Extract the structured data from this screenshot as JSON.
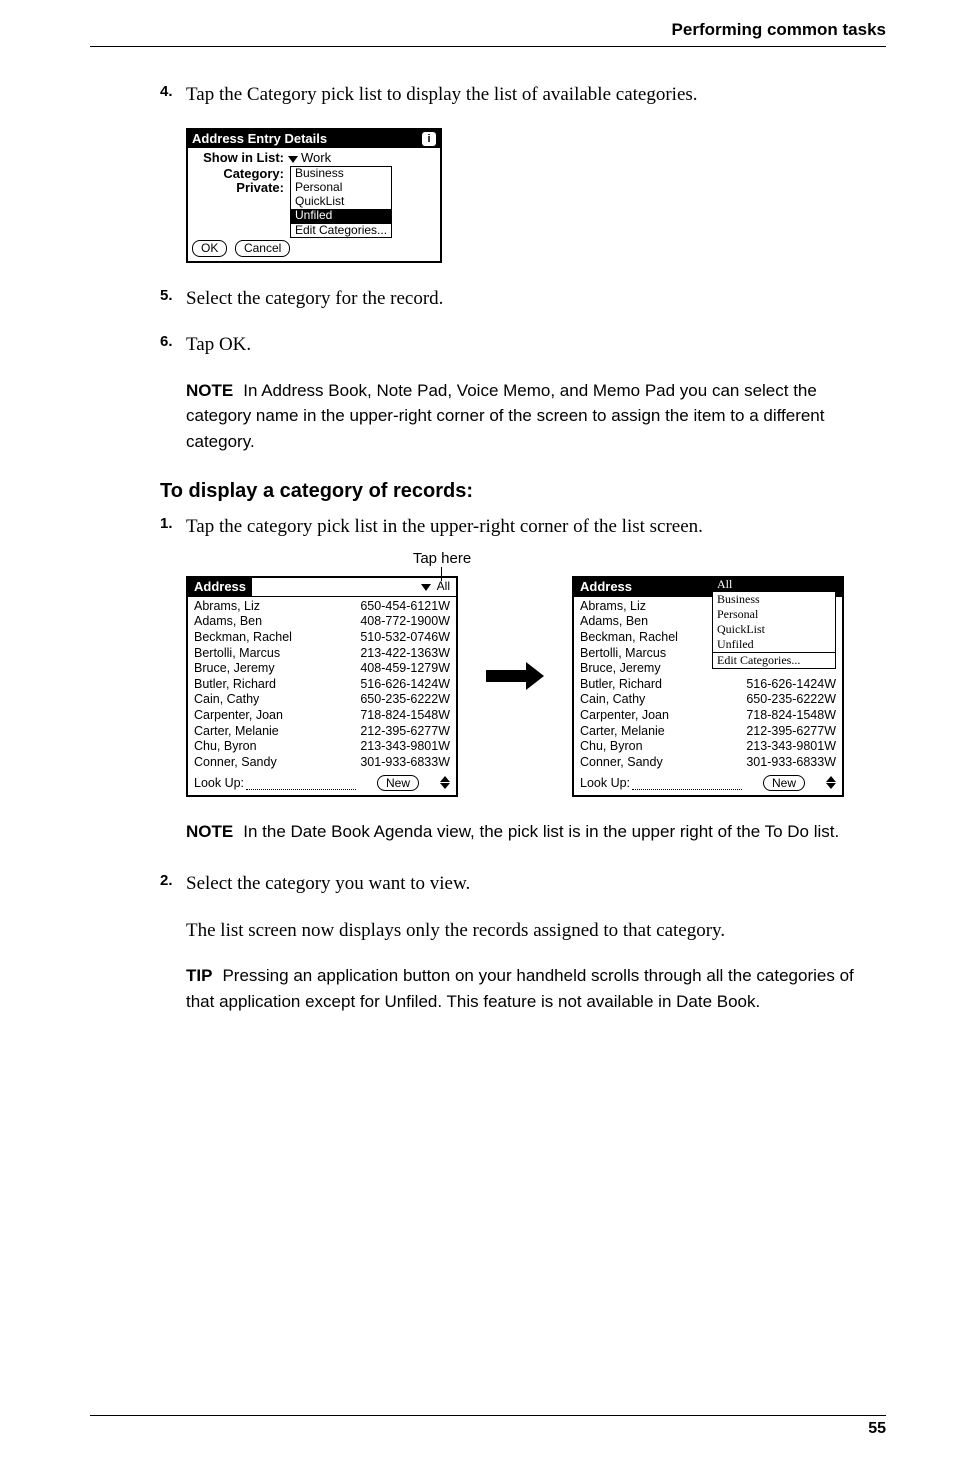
{
  "header": {
    "title": "Performing common tasks"
  },
  "steps_a": [
    {
      "num": "4.",
      "text": "Tap the Category pick list to display the list of available categories."
    },
    {
      "num": "5.",
      "text": "Select the category for the record."
    },
    {
      "num": "6.",
      "text": "Tap OK."
    }
  ],
  "detail_dialog": {
    "title": "Address Entry Details",
    "row1_label": "Show in List:",
    "row1_value": "Work",
    "row2_label": "Category:",
    "row3_label": "Private:",
    "options": [
      "Business",
      "Personal",
      "QuickList",
      "Unfiled",
      "Edit Categories..."
    ],
    "selected_index": 3,
    "ok": "OK",
    "cancel": "Cancel"
  },
  "note1": {
    "label": "NOTE",
    "text": "In Address Book, Note Pad, Voice Memo, and Memo Pad you can select the category name in the upper-right corner of the screen to assign the item to a different category."
  },
  "subsection": "To display a category of records:",
  "steps_b": [
    {
      "num": "1.",
      "text": "Tap the category pick list in the upper-right corner of the list screen."
    }
  ],
  "tap_here": "Tap here",
  "address_screen": {
    "title": "Address",
    "category": "All",
    "rows": [
      {
        "name": "Abrams, Liz",
        "phone": "650-454-6121W"
      },
      {
        "name": "Adams, Ben",
        "phone": "408-772-1900W"
      },
      {
        "name": "Beckman, Rachel",
        "phone": "510-532-0746W"
      },
      {
        "name": "Bertolli, Marcus",
        "phone": "213-422-1363W"
      },
      {
        "name": "Bruce, Jeremy",
        "phone": "408-459-1279W"
      },
      {
        "name": "Butler, Richard",
        "phone": "516-626-1424W"
      },
      {
        "name": "Cain, Cathy",
        "phone": "650-235-6222W"
      },
      {
        "name": "Carpenter, Joan",
        "phone": "718-824-1548W"
      },
      {
        "name": "Carter, Melanie",
        "phone": "212-395-6277W"
      },
      {
        "name": "Chu, Byron",
        "phone": "213-343-9801W"
      },
      {
        "name": "Conner, Sandy",
        "phone": "301-933-6833W"
      }
    ],
    "lookup": "Look Up:",
    "new_btn": "New"
  },
  "address_screen2": {
    "title": "Address",
    "dropdown_header": "All",
    "dropdown_options": [
      "Business",
      "Personal",
      "QuickList",
      "Unfiled",
      "Edit Categories..."
    ],
    "rows": [
      {
        "name": "Abrams, Liz",
        "phone": ""
      },
      {
        "name": "Adams, Ben",
        "phone": ""
      },
      {
        "name": "Beckman, Rachel",
        "phone": ""
      },
      {
        "name": "Bertolli, Marcus",
        "phone": ""
      },
      {
        "name": "Bruce, Jeremy",
        "phone": ""
      },
      {
        "name": "Butler, Richard",
        "phone": "516-626-1424W"
      },
      {
        "name": "Cain, Cathy",
        "phone": "650-235-6222W"
      },
      {
        "name": "Carpenter, Joan",
        "phone": "718-824-1548W"
      },
      {
        "name": "Carter, Melanie",
        "phone": "212-395-6277W"
      },
      {
        "name": "Chu, Byron",
        "phone": "213-343-9801W"
      },
      {
        "name": "Conner, Sandy",
        "phone": "301-933-6833W"
      }
    ],
    "lookup": "Look Up:",
    "new_btn": "New"
  },
  "note2": {
    "label": "NOTE",
    "text": "In the Date Book Agenda view, the pick list is in the upper right of the To Do list."
  },
  "steps_c": [
    {
      "num": "2.",
      "text": "Select the category you want to view."
    }
  ],
  "followup": "The list screen now displays only the records assigned to that category.",
  "tip": {
    "label": "TIP",
    "text": "Pressing an application button on your handheld scrolls through all the categories of that application except for Unfiled. This feature is not available in Date Book."
  },
  "page_number": "55"
}
